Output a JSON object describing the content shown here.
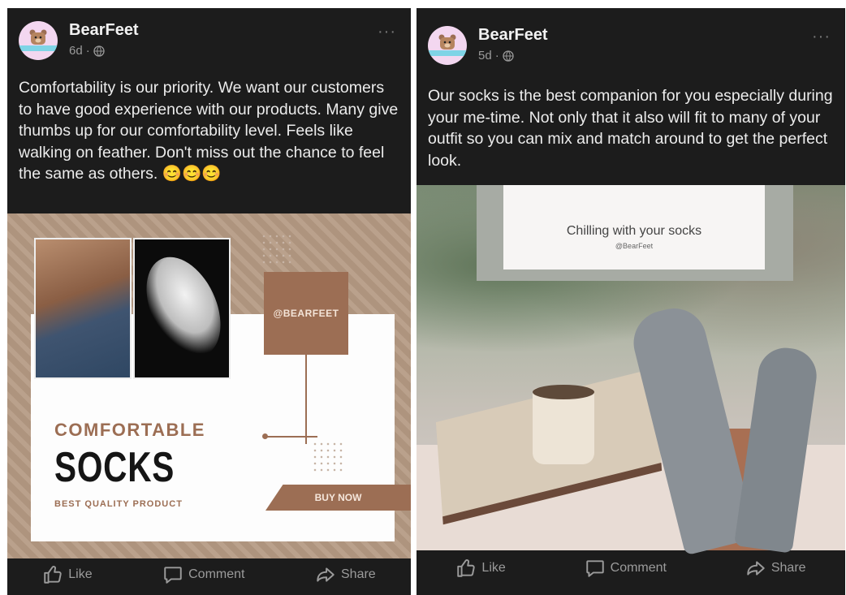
{
  "posts": [
    {
      "page_name": "BearFeet",
      "time": "6d",
      "more": "···",
      "text": "Comfortability is our priority. We want our customers to have good experience with our products. Many give thumbs up for our comfortability level. Feels like walking on feather. Don't miss out the chance to feel the same as others. 😊😊😊",
      "image": {
        "handle": "@BEARFEET",
        "headline": "COMFORTABLE",
        "title": "SOCKS",
        "subtitle": "BEST QUALITY PRODUCT",
        "cta": "BUY NOW"
      },
      "actions": {
        "like": "Like",
        "comment": "Comment",
        "share": "Share"
      }
    },
    {
      "page_name": "BearFeet",
      "time": "5d",
      "more": "···",
      "text": "Our socks is the best companion for you  especially during your me-time. Not only that it also will fit to many of your outfit so you can mix and match around to get the perfect look.",
      "image": {
        "banner_title": "Chilling with your socks",
        "banner_handle": "@BearFeet"
      },
      "actions": {
        "like": "Like",
        "comment": "Comment",
        "share": "Share"
      }
    }
  ],
  "colors": {
    "post_bg": "#1c1c1c",
    "accent_brown": "#9c6e54",
    "avatar_pink": "#f3d7f0"
  },
  "icons": [
    "globe-icon",
    "more-icon",
    "like-icon",
    "comment-icon",
    "share-icon"
  ]
}
